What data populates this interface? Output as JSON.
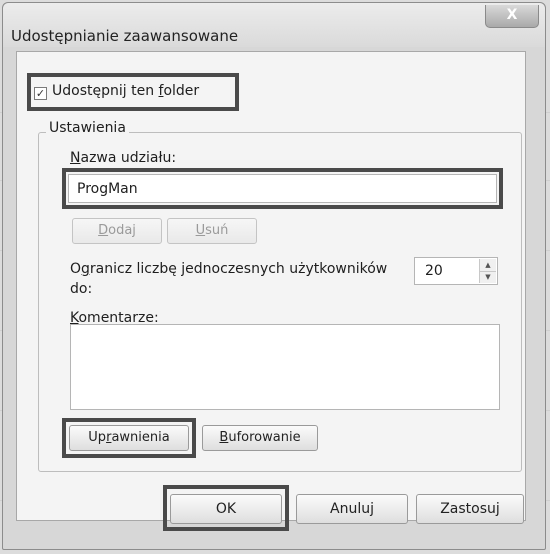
{
  "window": {
    "title": "Udostępnianie zaawansowane",
    "close_label": "X"
  },
  "share": {
    "checkbox_checked": true,
    "checkbox_label": "Udostępnij ten folder",
    "checkbox_label_access_key": "f"
  },
  "settings": {
    "group_label": "Ustawienia",
    "share_name_label": "Nazwa udziału:",
    "share_name_value": "ProgMan",
    "add_label": "Dodaj",
    "remove_label": "Usuń",
    "limit_label_line1": "Ogranicz liczbę jednoczesnych użytkowników",
    "limit_label_line2": "do:",
    "limit_value": "20",
    "comments_label": "Komentarze:",
    "comments_value": "",
    "permissions_label": "Uprawnienia",
    "caching_label": "Buforowanie"
  },
  "footer": {
    "ok_label": "OK",
    "cancel_label": "Anuluj",
    "apply_label": "Zastosuj"
  },
  "colors": {
    "highlight_border": "#4a4a4a",
    "dialog_background": "#f4f4f4"
  }
}
